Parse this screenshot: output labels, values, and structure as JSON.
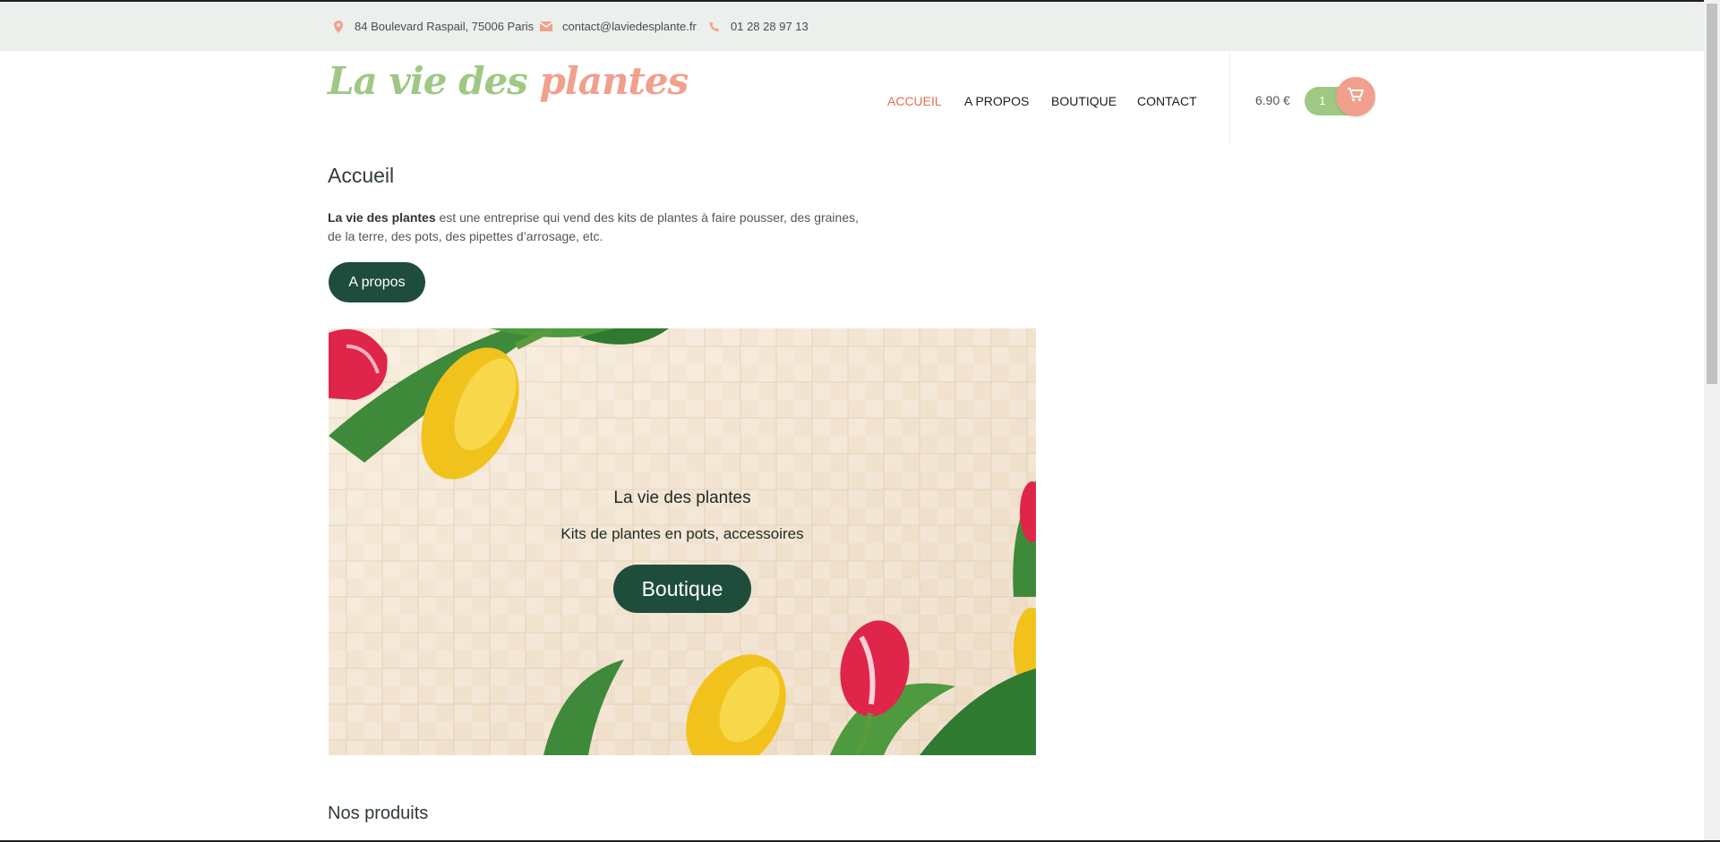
{
  "topbar": {
    "address": "84 Boulevard Raspail, 75006 Paris",
    "email": "contact@laviedesplante.fr",
    "phone": "01 28 28 97 13",
    "icon_color": "#f0a08c"
  },
  "logo": {
    "part1": "La vie des",
    "part2": "plantes"
  },
  "nav": {
    "items": [
      {
        "label": "ACCUEIL",
        "active": true
      },
      {
        "label": "A PROPOS"
      },
      {
        "label": "BOUTIQUE"
      },
      {
        "label": "CONTACT"
      }
    ],
    "active_color": "#e46d52"
  },
  "cart": {
    "total": "6.90 €",
    "count": "1",
    "icon": "cart-icon"
  },
  "main": {
    "title": "Accueil",
    "intro_bold": "La vie des plantes",
    "intro_rest": "est une entreprise qui vend des kits de plantes à faire pousser, des graines, de la terre, des pots, des pipettes d’arrosage, etc.",
    "apropos_button": "A propos"
  },
  "hero": {
    "title": "La vie des plantes",
    "subtitle": "Kits de plantes en pots, accessoires",
    "button": "Boutique"
  },
  "products_title": "Nos produits",
  "colors": {
    "brand_green": "#9ec884",
    "brand_pink": "#f0a08c",
    "dark_green": "#1e4d3b",
    "topbar_bg": "#ecf0ed"
  }
}
